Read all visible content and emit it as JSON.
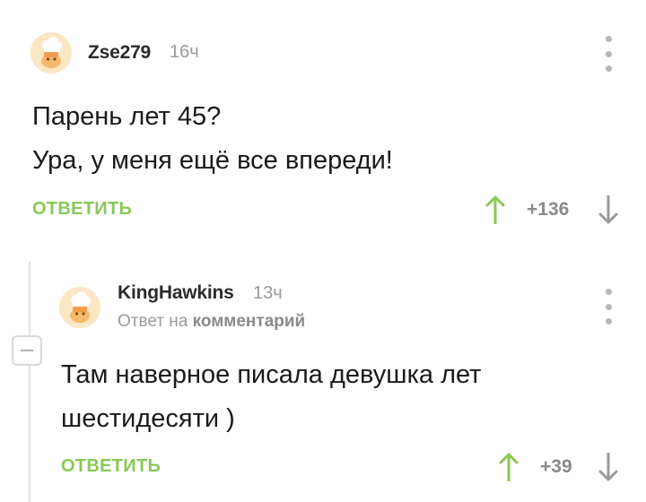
{
  "comments": [
    {
      "author": "Zse279",
      "time": "16ч",
      "body_lines": [
        "Парень лет 45?",
        "Ура, у меня ещё все впереди!"
      ],
      "reply_label": "ОТВЕТИТЬ",
      "rating": "+136"
    },
    {
      "author": "KingHawkins",
      "time": "13ч",
      "reply_to_prefix": "Ответ на",
      "reply_to_link": "комментарий",
      "body_lines": [
        "Там наверное писала девушка лет",
        "шестидесяти )"
      ],
      "reply_label": "ОТВЕТИТЬ",
      "rating": "+39"
    }
  ],
  "colors": {
    "accent_green": "#8ac858",
    "muted_gray": "#9a9a9a",
    "avatar_bg": "#fbe7c4"
  },
  "icons": [
    "avatar-chef",
    "more-vert-icon",
    "arrow-up-icon",
    "arrow-down-icon",
    "collapse-minus-icon"
  ]
}
